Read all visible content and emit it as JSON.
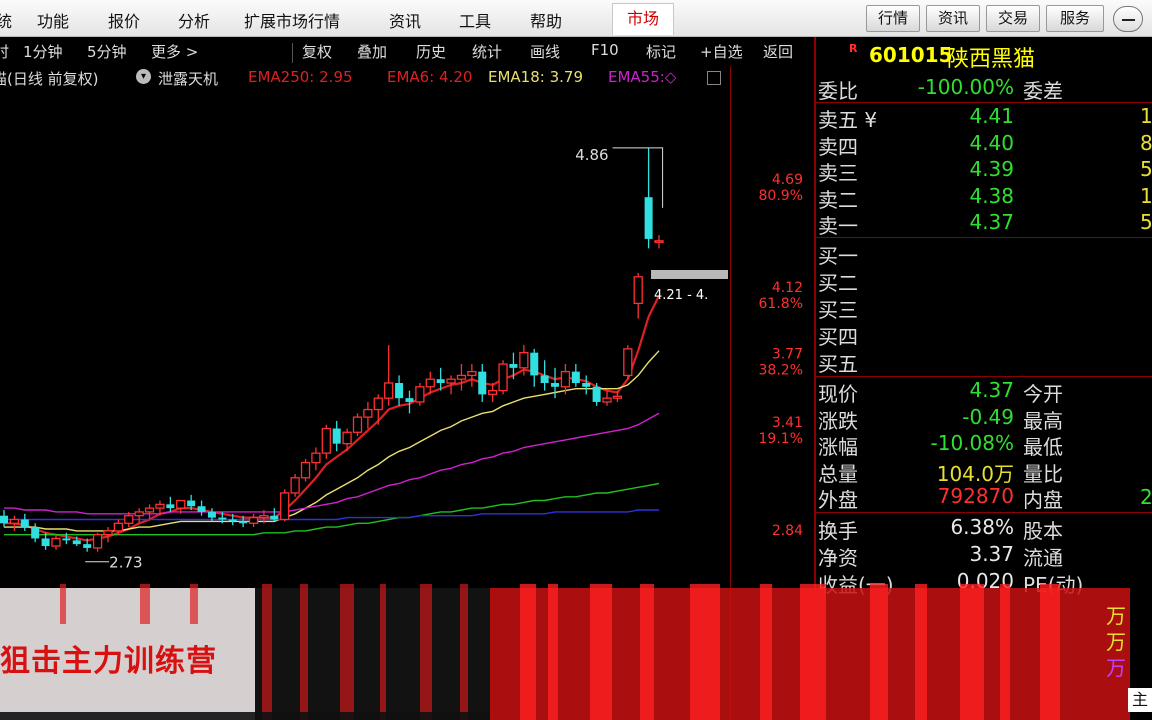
{
  "menu": {
    "items": [
      "统",
      "功能",
      "报价",
      "分析",
      "扩展市场行情",
      "资讯",
      "工具",
      "帮助"
    ],
    "active_tab": "市场",
    "right_buttons": [
      "行情",
      "资讯",
      "交易",
      "服务"
    ]
  },
  "toolbar": {
    "periods": [
      "时",
      "1分钟",
      "5分钟",
      "更多 >"
    ],
    "tools": [
      "复权",
      "叠加",
      "历史",
      "统计",
      "画线",
      "F10",
      "标记",
      "+自选",
      "返回"
    ]
  },
  "indicator": {
    "title": "猫(日线 前复权)",
    "name": "泄露天机",
    "ema250_label": "EMA250: 2.95",
    "ema6_label": "EMA6: 4.20",
    "ema18_label": "EMA18: 3.79",
    "ema55_label": "EMA55:◇"
  },
  "chart_data": {
    "type": "candlestick",
    "title": "猫(日线 前复权)",
    "price_ticks": [
      "4.69",
      "4.12",
      "3.77",
      "3.41",
      "2.84"
    ],
    "pct_ticks": [
      "80.9%",
      "61.8%",
      "38.2%",
      "19.1%"
    ],
    "high_annotation": "4.86",
    "low_annotation": "2.73",
    "range_label": "4.21 - 4.",
    "candles": [
      {
        "o": 2.92,
        "h": 2.95,
        "l": 2.86,
        "c": 2.88
      },
      {
        "o": 2.88,
        "h": 2.92,
        "l": 2.84,
        "c": 2.9
      },
      {
        "o": 2.9,
        "h": 2.93,
        "l": 2.84,
        "c": 2.86
      },
      {
        "o": 2.86,
        "h": 2.88,
        "l": 2.78,
        "c": 2.8
      },
      {
        "o": 2.8,
        "h": 2.83,
        "l": 2.74,
        "c": 2.76
      },
      {
        "o": 2.76,
        "h": 2.82,
        "l": 2.74,
        "c": 2.8
      },
      {
        "o": 2.8,
        "h": 2.83,
        "l": 2.77,
        "c": 2.79
      },
      {
        "o": 2.79,
        "h": 2.81,
        "l": 2.76,
        "c": 2.77
      },
      {
        "o": 2.77,
        "h": 2.8,
        "l": 2.73,
        "c": 2.75
      },
      {
        "o": 2.75,
        "h": 2.83,
        "l": 2.73,
        "c": 2.82
      },
      {
        "o": 2.82,
        "h": 2.86,
        "l": 2.78,
        "c": 2.84
      },
      {
        "o": 2.84,
        "h": 2.9,
        "l": 2.82,
        "c": 2.88
      },
      {
        "o": 2.88,
        "h": 2.94,
        "l": 2.86,
        "c": 2.92
      },
      {
        "o": 2.92,
        "h": 2.96,
        "l": 2.88,
        "c": 2.94
      },
      {
        "o": 2.94,
        "h": 2.98,
        "l": 2.9,
        "c": 2.96
      },
      {
        "o": 2.96,
        "h": 3.0,
        "l": 2.92,
        "c": 2.98
      },
      {
        "o": 2.98,
        "h": 3.02,
        "l": 2.94,
        "c": 2.96
      },
      {
        "o": 2.96,
        "h": 3.0,
        "l": 2.93,
        "c": 3.0
      },
      {
        "o": 3.0,
        "h": 3.03,
        "l": 2.95,
        "c": 2.97
      },
      {
        "o": 2.97,
        "h": 3.0,
        "l": 2.92,
        "c": 2.94
      },
      {
        "o": 2.94,
        "h": 2.96,
        "l": 2.89,
        "c": 2.91
      },
      {
        "o": 2.91,
        "h": 2.94,
        "l": 2.88,
        "c": 2.9
      },
      {
        "o": 2.9,
        "h": 2.93,
        "l": 2.87,
        "c": 2.89
      },
      {
        "o": 2.89,
        "h": 2.92,
        "l": 2.86,
        "c": 2.88
      },
      {
        "o": 2.88,
        "h": 2.93,
        "l": 2.86,
        "c": 2.91
      },
      {
        "o": 2.91,
        "h": 2.95,
        "l": 2.88,
        "c": 2.92
      },
      {
        "o": 2.92,
        "h": 2.96,
        "l": 2.89,
        "c": 2.9
      },
      {
        "o": 2.9,
        "h": 3.06,
        "l": 2.89,
        "c": 3.04
      },
      {
        "o": 3.04,
        "h": 3.14,
        "l": 3.02,
        "c": 3.12
      },
      {
        "o": 3.12,
        "h": 3.22,
        "l": 3.1,
        "c": 3.2
      },
      {
        "o": 3.2,
        "h": 3.28,
        "l": 3.16,
        "c": 3.25
      },
      {
        "o": 3.25,
        "h": 3.4,
        "l": 3.22,
        "c": 3.38
      },
      {
        "o": 3.38,
        "h": 3.42,
        "l": 3.26,
        "c": 3.3
      },
      {
        "o": 3.3,
        "h": 3.38,
        "l": 3.26,
        "c": 3.36
      },
      {
        "o": 3.36,
        "h": 3.46,
        "l": 3.34,
        "c": 3.44
      },
      {
        "o": 3.44,
        "h": 3.52,
        "l": 3.38,
        "c": 3.48
      },
      {
        "o": 3.48,
        "h": 3.56,
        "l": 3.4,
        "c": 3.54
      },
      {
        "o": 3.54,
        "h": 3.82,
        "l": 3.5,
        "c": 3.62
      },
      {
        "o": 3.62,
        "h": 3.66,
        "l": 3.5,
        "c": 3.54
      },
      {
        "o": 3.54,
        "h": 3.58,
        "l": 3.46,
        "c": 3.52
      },
      {
        "o": 3.52,
        "h": 3.62,
        "l": 3.5,
        "c": 3.6
      },
      {
        "o": 3.6,
        "h": 3.68,
        "l": 3.56,
        "c": 3.64
      },
      {
        "o": 3.64,
        "h": 3.7,
        "l": 3.58,
        "c": 3.62
      },
      {
        "o": 3.62,
        "h": 3.66,
        "l": 3.56,
        "c": 3.64
      },
      {
        "o": 3.64,
        "h": 3.72,
        "l": 3.58,
        "c": 3.66
      },
      {
        "o": 3.66,
        "h": 3.72,
        "l": 3.6,
        "c": 3.68
      },
      {
        "o": 3.68,
        "h": 3.72,
        "l": 3.52,
        "c": 3.56
      },
      {
        "o": 3.56,
        "h": 3.62,
        "l": 3.52,
        "c": 3.58
      },
      {
        "o": 3.58,
        "h": 3.74,
        "l": 3.56,
        "c": 3.72
      },
      {
        "o": 3.72,
        "h": 3.78,
        "l": 3.64,
        "c": 3.7
      },
      {
        "o": 3.7,
        "h": 3.82,
        "l": 3.66,
        "c": 3.78
      },
      {
        "o": 3.78,
        "h": 3.8,
        "l": 3.6,
        "c": 3.66
      },
      {
        "o": 3.66,
        "h": 3.74,
        "l": 3.58,
        "c": 3.62
      },
      {
        "o": 3.62,
        "h": 3.7,
        "l": 3.54,
        "c": 3.6
      },
      {
        "o": 3.6,
        "h": 3.72,
        "l": 3.56,
        "c": 3.68
      },
      {
        "o": 3.68,
        "h": 3.72,
        "l": 3.6,
        "c": 3.62
      },
      {
        "o": 3.62,
        "h": 3.66,
        "l": 3.56,
        "c": 3.6
      },
      {
        "o": 3.6,
        "h": 3.62,
        "l": 3.5,
        "c": 3.52
      },
      {
        "o": 3.52,
        "h": 3.58,
        "l": 3.5,
        "c": 3.54
      },
      {
        "o": 3.54,
        "h": 3.58,
        "l": 3.52,
        "c": 3.55
      },
      {
        "o": 3.66,
        "h": 3.82,
        "l": 3.64,
        "c": 3.8
      },
      {
        "o": 4.04,
        "h": 4.2,
        "l": 3.96,
        "c": 4.18
      },
      {
        "o": 4.6,
        "h": 4.86,
        "l": 4.33,
        "c": 4.38
      },
      {
        "o": 4.37,
        "h": 4.4,
        "l": 4.33,
        "c": 4.37
      }
    ],
    "ema_series": [
      {
        "name": "EMA6",
        "color": "#e02020",
        "values": [
          2.88,
          2.88,
          2.87,
          2.85,
          2.83,
          2.82,
          2.81,
          2.8,
          2.79,
          2.8,
          2.81,
          2.83,
          2.85,
          2.88,
          2.9,
          2.93,
          2.94,
          2.96,
          2.96,
          2.95,
          2.94,
          2.93,
          2.92,
          2.91,
          2.91,
          2.91,
          2.91,
          2.95,
          3.0,
          3.06,
          3.12,
          3.19,
          3.23,
          3.27,
          3.32,
          3.37,
          3.42,
          3.48,
          3.5,
          3.51,
          3.54,
          3.57,
          3.59,
          3.61,
          3.62,
          3.64,
          3.62,
          3.61,
          3.64,
          3.66,
          3.69,
          3.68,
          3.66,
          3.64,
          3.65,
          3.64,
          3.63,
          3.6,
          3.58,
          3.57,
          3.64,
          3.79,
          3.97,
          4.08
        ]
      },
      {
        "name": "EMA18",
        "color": "#e8e070",
        "values": [
          2.86,
          2.86,
          2.86,
          2.86,
          2.85,
          2.85,
          2.85,
          2.84,
          2.84,
          2.84,
          2.84,
          2.84,
          2.85,
          2.86,
          2.86,
          2.87,
          2.88,
          2.89,
          2.89,
          2.89,
          2.89,
          2.89,
          2.89,
          2.89,
          2.89,
          2.89,
          2.89,
          2.91,
          2.93,
          2.96,
          2.99,
          3.03,
          3.06,
          3.09,
          3.12,
          3.16,
          3.19,
          3.23,
          3.26,
          3.28,
          3.31,
          3.34,
          3.37,
          3.39,
          3.42,
          3.44,
          3.46,
          3.47,
          3.5,
          3.52,
          3.54,
          3.55,
          3.56,
          3.57,
          3.58,
          3.59,
          3.59,
          3.59,
          3.59,
          3.59,
          3.61,
          3.66,
          3.73,
          3.79
        ]
      },
      {
        "name": "EMA55",
        "color": "#d020d0",
        "values": [
          2.96,
          2.96,
          2.95,
          2.95,
          2.95,
          2.94,
          2.94,
          2.94,
          2.93,
          2.93,
          2.93,
          2.93,
          2.93,
          2.93,
          2.93,
          2.93,
          2.94,
          2.94,
          2.94,
          2.94,
          2.94,
          2.94,
          2.94,
          2.94,
          2.94,
          2.94,
          2.94,
          2.94,
          2.95,
          2.96,
          2.97,
          2.98,
          2.99,
          3.01,
          3.02,
          3.04,
          3.06,
          3.08,
          3.09,
          3.11,
          3.12,
          3.14,
          3.16,
          3.17,
          3.19,
          3.2,
          3.22,
          3.23,
          3.25,
          3.26,
          3.28,
          3.29,
          3.3,
          3.31,
          3.32,
          3.33,
          3.34,
          3.35,
          3.36,
          3.37,
          3.38,
          3.4,
          3.43,
          3.46
        ]
      },
      {
        "name": "EMA",
        "color": "#20c020",
        "values": [
          2.82,
          2.82,
          2.82,
          2.82,
          2.82,
          2.82,
          2.82,
          2.82,
          2.82,
          2.82,
          2.82,
          2.82,
          2.82,
          2.82,
          2.82,
          2.82,
          2.82,
          2.82,
          2.82,
          2.82,
          2.82,
          2.82,
          2.82,
          2.82,
          2.82,
          2.83,
          2.83,
          2.83,
          2.84,
          2.84,
          2.85,
          2.86,
          2.86,
          2.87,
          2.88,
          2.88,
          2.89,
          2.9,
          2.91,
          2.91,
          2.92,
          2.93,
          2.94,
          2.94,
          2.95,
          2.96,
          2.96,
          2.97,
          2.98,
          2.98,
          2.99,
          3.0,
          3.0,
          3.01,
          3.02,
          3.02,
          3.03,
          3.04,
          3.04,
          3.05,
          3.06,
          3.07,
          3.08,
          3.09
        ]
      },
      {
        "name": "EMA250",
        "color": "#3030e0",
        "values": [
          2.9,
          2.9,
          2.9,
          2.9,
          2.9,
          2.9,
          2.9,
          2.9,
          2.9,
          2.9,
          2.9,
          2.9,
          2.9,
          2.9,
          2.9,
          2.9,
          2.9,
          2.9,
          2.9,
          2.9,
          2.9,
          2.9,
          2.9,
          2.9,
          2.9,
          2.9,
          2.9,
          2.9,
          2.9,
          2.9,
          2.9,
          2.9,
          2.9,
          2.91,
          2.91,
          2.91,
          2.91,
          2.91,
          2.91,
          2.91,
          2.92,
          2.92,
          2.92,
          2.92,
          2.92,
          2.92,
          2.93,
          2.93,
          2.93,
          2.93,
          2.93,
          2.93,
          2.93,
          2.94,
          2.94,
          2.94,
          2.94,
          2.94,
          2.94,
          2.94,
          2.94,
          2.95,
          2.95,
          2.95
        ]
      }
    ],
    "ylim": [
      2.66,
      5.06
    ]
  },
  "quote": {
    "stock_code": "601015",
    "stock_name": "陕西黑猫",
    "r_badge": "R",
    "weibi_label": "委比",
    "weibi_value": "-100.00%",
    "weicha_label": "委差",
    "sell": [
      {
        "label": "卖五 ¥",
        "price": "4.41",
        "vol": "1"
      },
      {
        "label": "卖四",
        "price": "4.40",
        "vol": "8"
      },
      {
        "label": "卖三",
        "price": "4.39",
        "vol": "5"
      },
      {
        "label": "卖二",
        "price": "4.38",
        "vol": "1"
      },
      {
        "label": "卖一",
        "price": "4.37",
        "vol": "5"
      }
    ],
    "buy": [
      "买一",
      "买二",
      "买三",
      "买四",
      "买五"
    ],
    "stats": [
      {
        "label": "现价",
        "value": "4.37",
        "color": "#30e030",
        "extra": "今开"
      },
      {
        "label": "涨跌",
        "value": "-0.49",
        "color": "#30e030",
        "extra": "最高"
      },
      {
        "label": "涨幅",
        "value": "-10.08%",
        "color": "#30e030",
        "extra": "最低"
      },
      {
        "label": "总量",
        "value": "104.0万",
        "color": "#e8e030",
        "extra": "量比"
      },
      {
        "label": "外盘",
        "value": "792870",
        "color": "#ff3030",
        "extra": "内盘"
      }
    ],
    "inner_vol_partial": "2",
    "fundamentals": [
      {
        "label": "换手",
        "value": "6.38%",
        "extra": "股本"
      },
      {
        "label": "净资",
        "value": "3.37",
        "extra": "流通"
      },
      {
        "label": "收益(一)",
        "value": "0.020",
        "extra": "PE(动)"
      }
    ],
    "wan_units": [
      "万",
      "万",
      "万"
    ],
    "bottom_tab": "主"
  },
  "overlay": {
    "watermark": "狙击主力训练营"
  }
}
